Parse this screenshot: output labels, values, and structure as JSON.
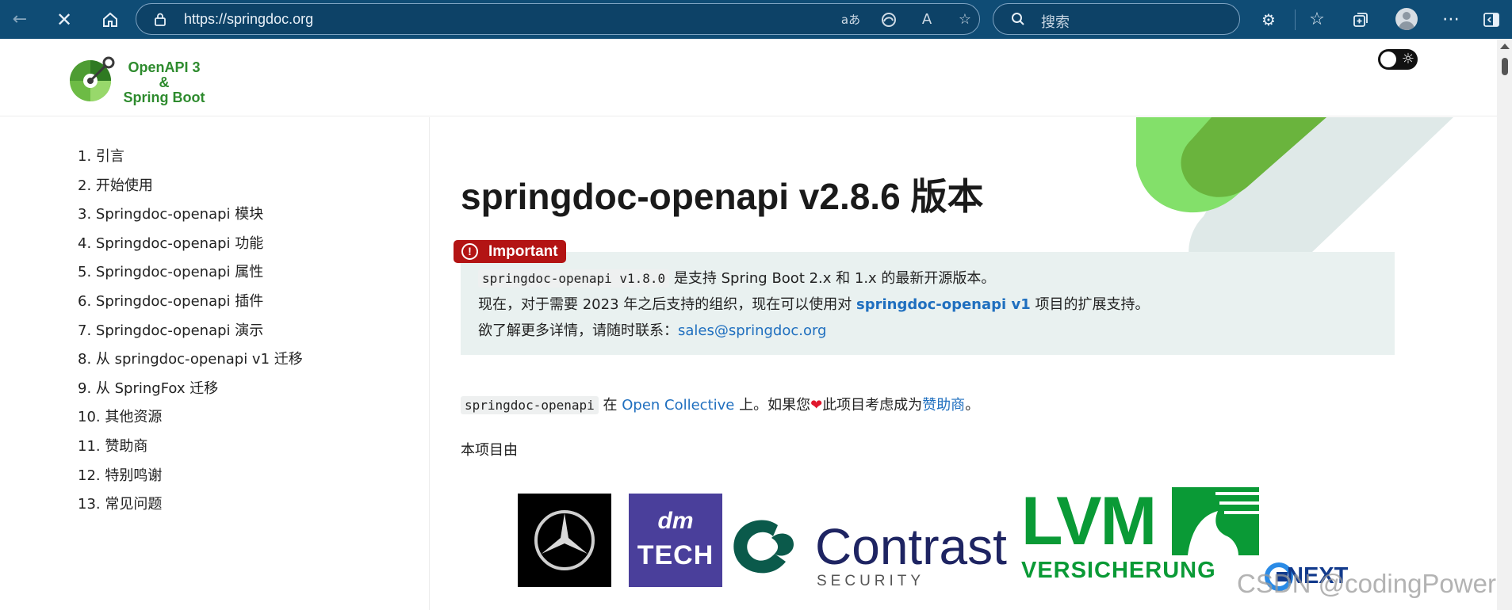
{
  "browser": {
    "url": "https://springdoc.org",
    "search_placeholder": "搜索",
    "translate_glyph": "aあ",
    "read_aloud_glyph": "A",
    "accent": "#0f4c75"
  },
  "site": {
    "logo_line1": "OpenAPI 3",
    "logo_line2": "&",
    "logo_line3": "Spring Boot"
  },
  "toc": {
    "items": [
      "1. 引言",
      "2. 开始使用",
      "3. Springdoc-openapi 模块",
      "4. Springdoc-openapi 功能",
      "5. Springdoc-openapi 属性",
      "6. Springdoc-openapi 插件",
      "7. Springdoc-openapi 演示",
      "8. 从 springdoc-openapi v1 迁移",
      "9. 从 SpringFox 迁移",
      "10. 其他资源",
      "11. 赞助商",
      "12. 特别鸣谢",
      "13. 常见问题"
    ]
  },
  "main": {
    "title": "springdoc-openapi v2.8.6 版本",
    "important_label": "Important",
    "important_icon": "!",
    "line1_code": "springdoc-openapi v1.8.0",
    "line1_text": " 是支持 Spring Boot 2.x 和 1.x 的最新开源版本。",
    "line2_text": "现在，对于需要 2023 年之后支持的组织，现在可以使用对 ",
    "line2_link": "springdoc-openapi v1",
    "line2_tail": " 项目的扩展支持。",
    "line3_text": "欲了解更多详情，请随时联系：",
    "line3_link": "sales@springdoc.org",
    "para_code": "springdoc-openapi",
    "para_text1": " 在 ",
    "para_link1": "Open Collective",
    "para_text2": " 上。如果您",
    "para_heart": "❤",
    "para_text3": "此项目考虑成为",
    "para_link2": "赞助商",
    "para_text4": "。",
    "sponsored_by": "本项目由"
  },
  "sponsors": {
    "dm_top": "dm",
    "dm_bottom": "TECH",
    "contrast_word": "Contrast",
    "contrast_sub": "SECURITY",
    "lvm_word": "LVM",
    "lvm_sub": "VERSICHERUNG",
    "next_word": "NEXT"
  },
  "watermark": "CSDN @codingPower"
}
